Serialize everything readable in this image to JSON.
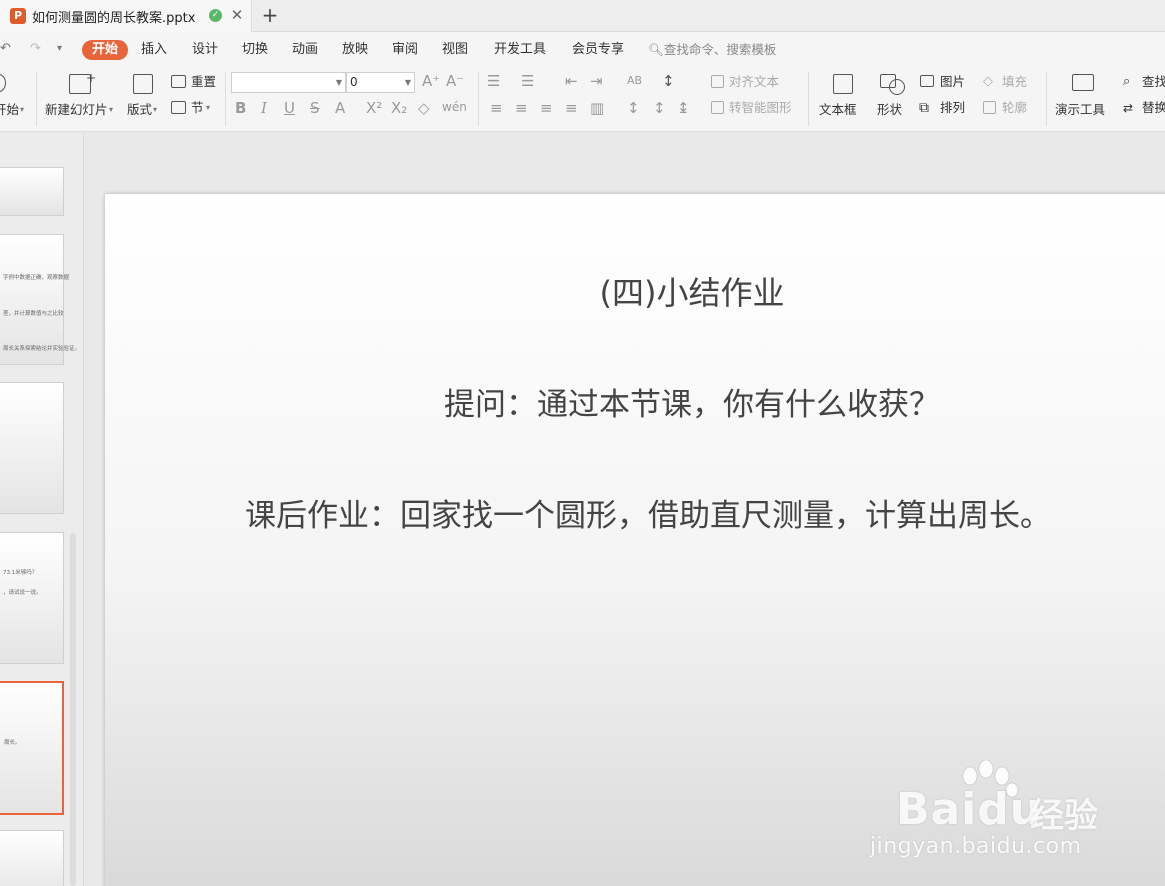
{
  "window": {
    "tab_title": "如何测量圆的周长教案.pptx",
    "app_icon": "P",
    "new_tab": "+"
  },
  "menu": {
    "active": "开始",
    "items": [
      "开始",
      "插入",
      "设计",
      "切换",
      "动画",
      "放映",
      "审阅",
      "视图",
      "开发工具",
      "会员专享"
    ],
    "search": "查找命令、搜索模板"
  },
  "ribbon": {
    "start_partial": "开始",
    "new_slide": "新建幻灯片",
    "layout": "版式",
    "reset": "重置",
    "section": "节",
    "font_name": "",
    "font_size": "0",
    "align_text": "对齐文本",
    "smart_shape": "转智能图形",
    "text_box": "文本框",
    "shape": "形状",
    "picture": "图片",
    "arrange": "排列",
    "fill": "填充",
    "outline": "轮廓",
    "present_tools": "演示工具",
    "find": "查找",
    "replace": "替换"
  },
  "thumbnails": {
    "t2_lines": [
      "字例中数据正确，观察数据",
      "差，并计算数值与之比较",
      "周长关系探索结论并实验验证。"
    ],
    "t4_lines": [
      "73.1米够吗？",
      "，请试说一说。"
    ],
    "t5_lines": [
      "周长。"
    ]
  },
  "slide": {
    "title": "(四)小结作业",
    "question": "提问：通过本节课，你有什么收获？",
    "homework": "课后作业：回家找一个圆形，借助直尺测量，计算出周长。"
  },
  "watermark": {
    "brand": "Baidu",
    "brand_cn": "经验",
    "url": "jingyan.baidu.com"
  }
}
